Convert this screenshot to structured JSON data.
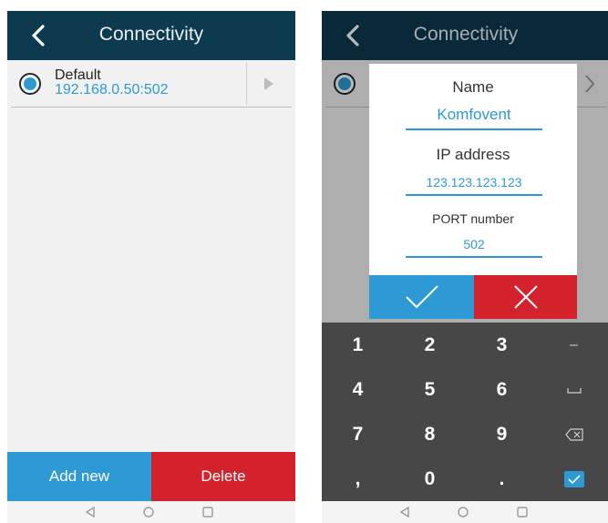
{
  "left_screen": {
    "app_bar": {
      "title": "Connectivity",
      "back_icon": "chevron-left-icon"
    },
    "connection": {
      "name": "Default",
      "address": "192.168.0.50:502",
      "selected": true,
      "arrow_icon": "triangle-right-icon"
    },
    "buttons": {
      "add_new": "Add new",
      "delete": "Delete"
    }
  },
  "right_screen": {
    "app_bar": {
      "title": "Connectivity"
    },
    "dialog": {
      "name_label": "Name",
      "name_value": "Komfovent",
      "ip_label": "IP address",
      "ip_value": "123.123.123.123",
      "port_label": "PORT number",
      "port_value": "502",
      "confirm_icon": "checkmark-icon",
      "cancel_icon": "close-icon"
    },
    "keyboard": {
      "keys": [
        "1",
        "2",
        "3",
        "–",
        "4",
        "5",
        "6",
        "space",
        "7",
        "8",
        "9",
        "backspace",
        ",",
        "0",
        ".",
        "done"
      ]
    }
  },
  "nav_bar": {
    "icons": [
      "back-triangle-icon",
      "home-circle-icon",
      "recents-square-icon"
    ]
  },
  "colors": {
    "app_bar": "#0d3a4e",
    "accent_blue": "#2d9ad5",
    "danger_red": "#d3222c",
    "keyboard_bg": "#474747",
    "screen_bg": "#f1f1f1"
  }
}
